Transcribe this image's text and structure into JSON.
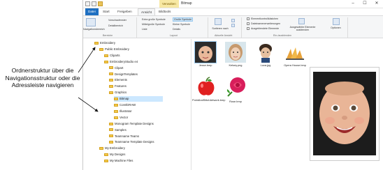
{
  "titlebar": {
    "contextual_tab": "Verwalten",
    "window_title": "Bitmap",
    "quick_access": [
      "save-icon",
      "undo-icon",
      "folder-icon"
    ]
  },
  "tabs": [
    "Datei",
    "Start",
    "Freigeben",
    "Ansicht",
    "Bildtools"
  ],
  "ribbon": {
    "pane_group": {
      "nav_pane": "Navigationsbereich",
      "preview": "Vorschaufenster",
      "details": "Detailbereich",
      "label": "Bereiche"
    },
    "layout_group": {
      "items": [
        "Extra große Symbole",
        "Große Symbole",
        "Mittelgroße Symbole",
        "Kleine Symbole",
        "Liste",
        "Details"
      ],
      "label": "Layout"
    },
    "current_view": {
      "sort": "Sortieren nach",
      "label": "Aktuelle Ansicht"
    },
    "show_hide": {
      "items": [
        "Elementkontrollkästchen",
        "Dateinamenerweiterungen",
        "Ausgeblendete Elemente"
      ],
      "hide_selected": "Ausgewählte Elemente ausblenden",
      "options": "Optionen",
      "label": "Ein-/ausblenden"
    }
  },
  "nav_tree": [
    {
      "label": "Embroidery",
      "indent": 0
    },
    {
      "label": "Public Embroidery",
      "indent": 1
    },
    {
      "label": "Cliparts",
      "indent": 2
    },
    {
      "label": "EmbroideryStudio e4",
      "indent": 2
    },
    {
      "label": "Clipart",
      "indent": 3
    },
    {
      "label": "DesignTemplates",
      "indent": 3
    },
    {
      "label": "Elements",
      "indent": 3
    },
    {
      "label": "Features",
      "indent": 3
    },
    {
      "label": "Graphics",
      "indent": 3
    },
    {
      "label": "Bitmap",
      "indent": 4,
      "selected": true
    },
    {
      "label": "CorelDRAW",
      "indent": 4
    },
    {
      "label": "Illustrator",
      "indent": 4
    },
    {
      "label": "Vector",
      "indent": 4
    },
    {
      "label": "Monogram Template Designs",
      "indent": 3
    },
    {
      "label": "Samples",
      "indent": 3
    },
    {
      "label": "Teamname Teams",
      "indent": 3
    },
    {
      "label": "Teamname Template Designs",
      "indent": 3
    },
    {
      "label": "My Embroidery",
      "indent": 1
    },
    {
      "label": "My Designs",
      "indent": 2
    },
    {
      "label": "My Machine Files",
      "indent": 2
    }
  ],
  "files": [
    {
      "name": "Jesse.bmp",
      "kind": "baby"
    },
    {
      "name": "Kelsey.png",
      "kind": "girl"
    },
    {
      "name": "Luca.jpg",
      "kind": "boy"
    },
    {
      "name": "Opera House.bmp",
      "kind": "opera"
    },
    {
      "name": "PointAndStitchArtwork.bmp",
      "kind": "apple"
    },
    {
      "name": "Rose.bmp",
      "kind": "rose"
    }
  ],
  "annotation": "Ordnerstruktur über die Navigationsstruktur oder die Adressleiste navigieren"
}
